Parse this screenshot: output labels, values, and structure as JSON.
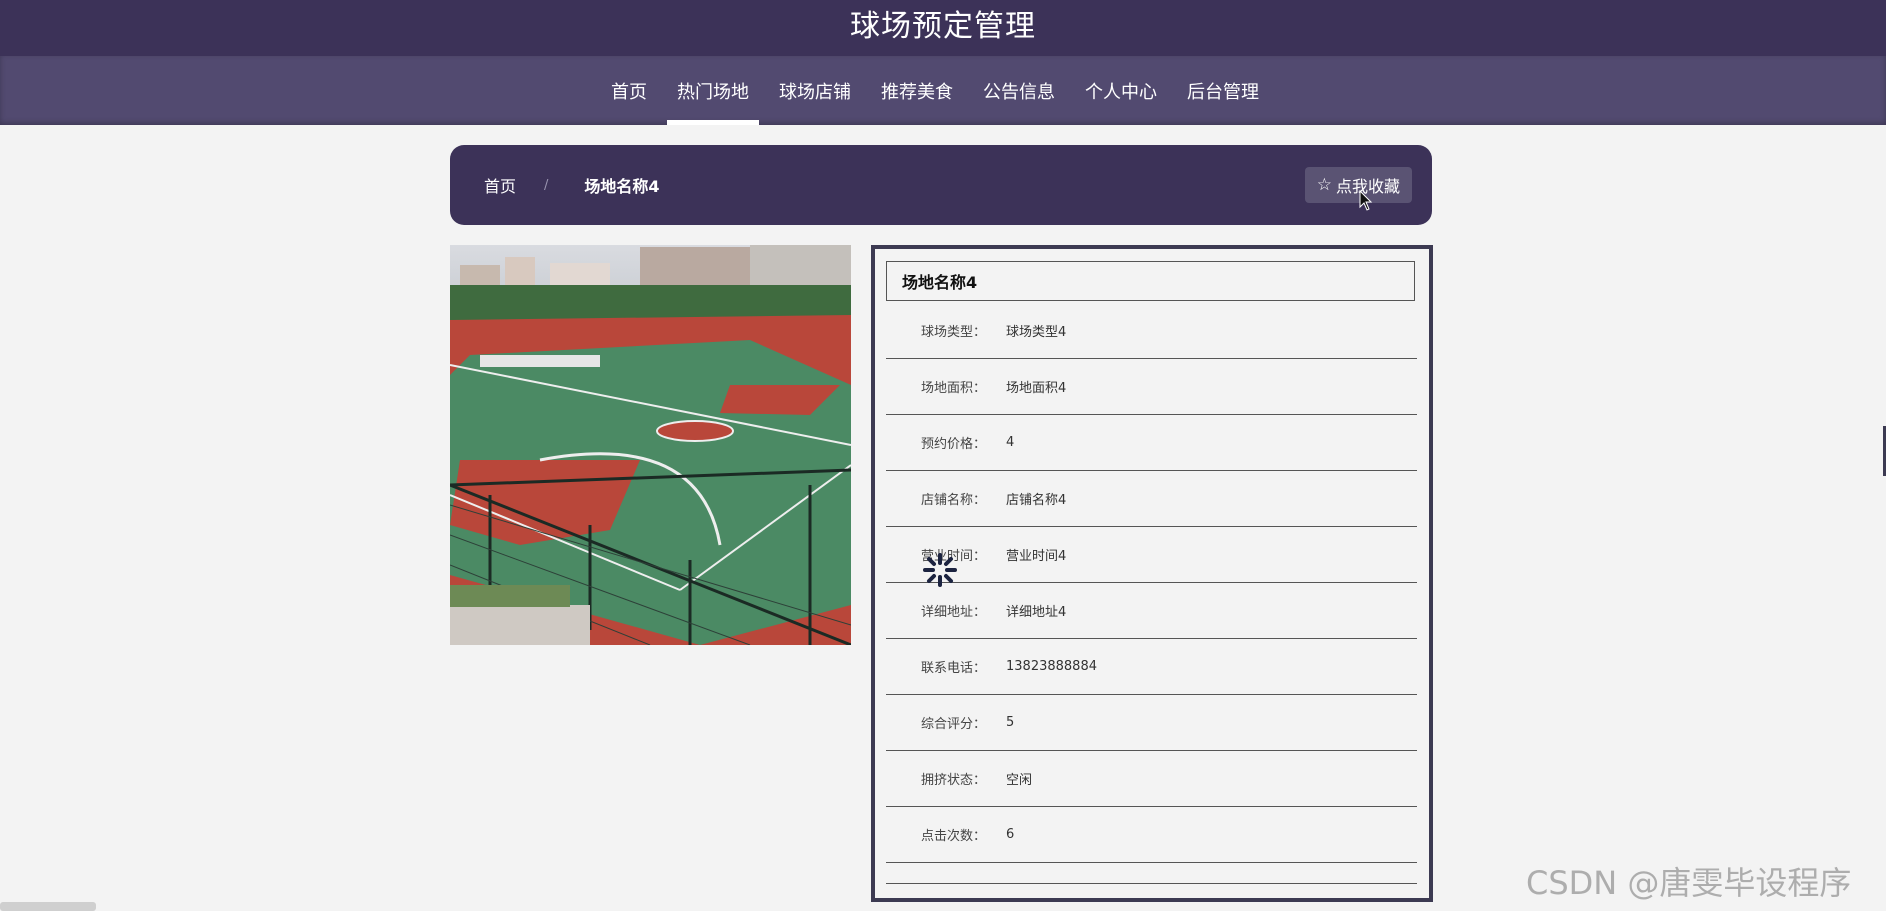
{
  "site": {
    "title": "球场预定管理"
  },
  "nav": {
    "items": [
      "首页",
      "热门场地",
      "球场店铺",
      "推荐美食",
      "公告信息",
      "个人中心",
      "后台管理"
    ],
    "active_index": 1
  },
  "breadcrumb": {
    "home": "首页",
    "separator": "/",
    "current": "场地名称4"
  },
  "favorite_button": {
    "icon": "star-outline-icon",
    "label": "点我收藏"
  },
  "detail": {
    "title": "场地名称4",
    "fields": [
      {
        "label": "球场类型：",
        "value": "球场类型4"
      },
      {
        "label": "场地面积：",
        "value": "场地面积4"
      },
      {
        "label": "预约价格：",
        "value": "4"
      },
      {
        "label": "店铺名称：",
        "value": "店铺名称4"
      },
      {
        "label": "营业时间：",
        "value": "营业时间4"
      },
      {
        "label": "详细地址：",
        "value": "详细地址4"
      },
      {
        "label": "联系电话：",
        "value": "13823888884"
      },
      {
        "label": "综合评分：",
        "value": "5"
      },
      {
        "label": "拥挤状态：",
        "value": "空闲"
      },
      {
        "label": "点击次数：",
        "value": "6"
      }
    ]
  },
  "watermark": "CSDN @唐雯毕设程序",
  "colors": {
    "header": "#3c3258",
    "nav": "#524a70",
    "background": "#f3f3f3"
  }
}
